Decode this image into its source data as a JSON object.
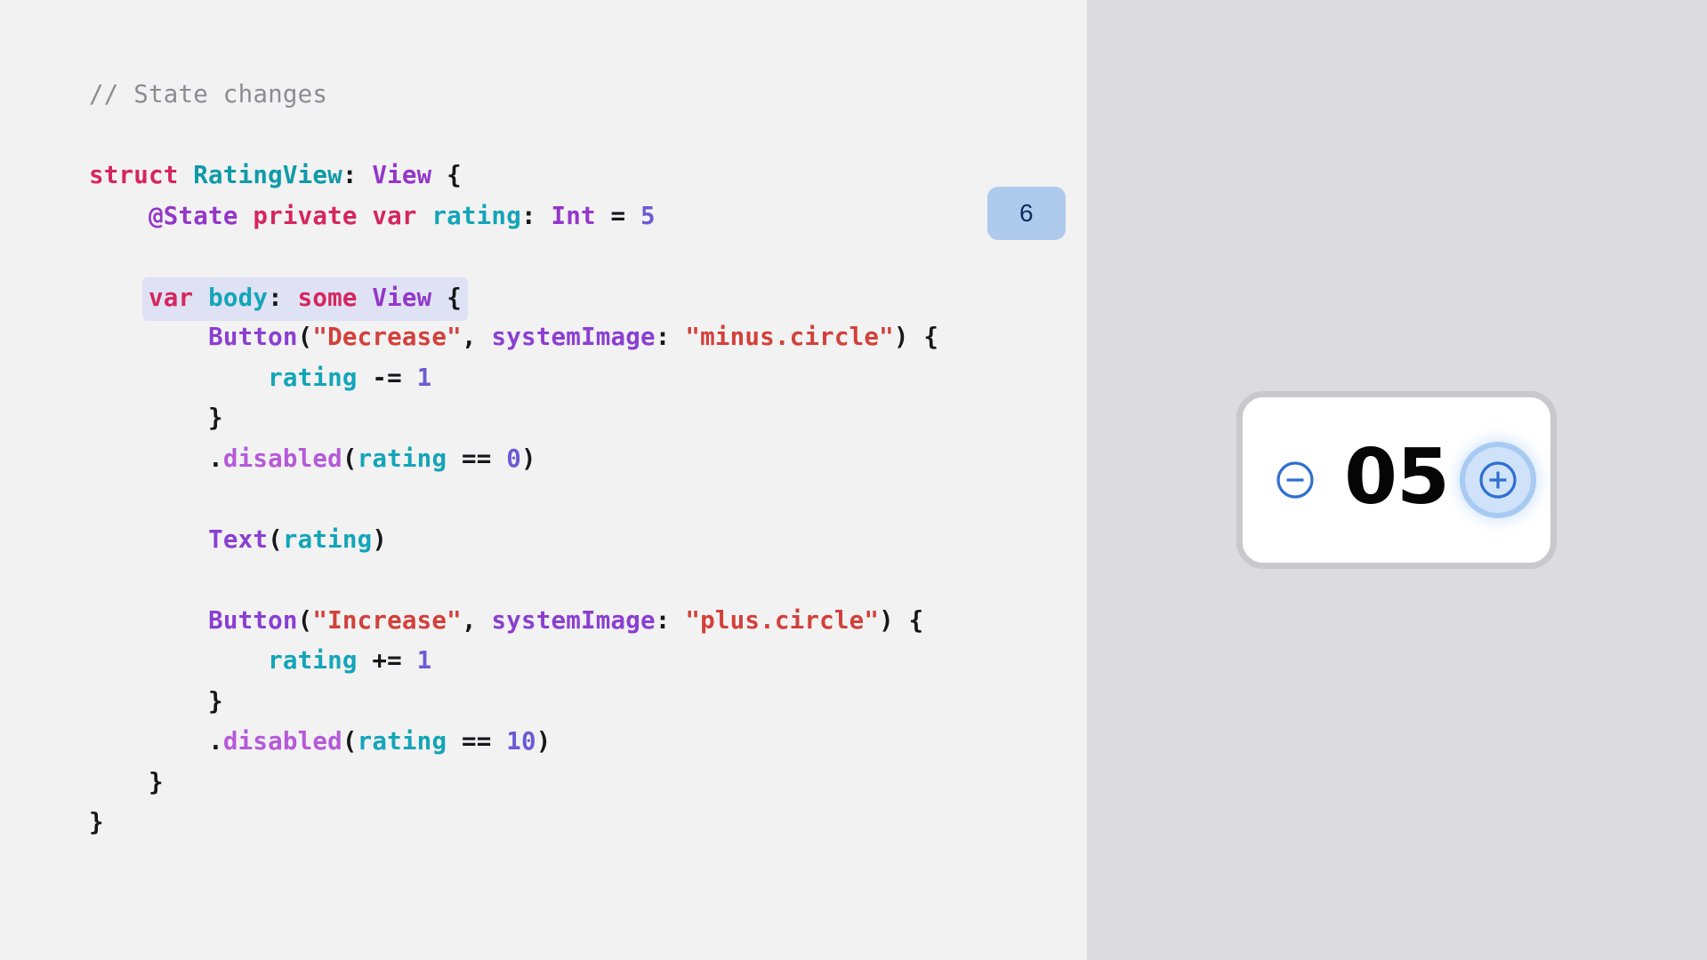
{
  "colors": {
    "left_panel_bg": "#f2f2f3",
    "right_panel_bg": "#dcdce0",
    "badge_bg": "#aecbee",
    "badge_text": "#10295c",
    "highlight_band": "#dfe2f4",
    "card_bg": "#ffffff",
    "card_border": "#c8c8cd",
    "accent_blue": "#2f6fd0",
    "focus_ring": "#a8caf2",
    "focus_fill": "#cfe2fa"
  },
  "code": {
    "language": "swift",
    "lines": [
      {
        "id": "line-comment",
        "highlight": false,
        "tokens": [
          {
            "text": "// State changes",
            "cls": "t-comment"
          }
        ]
      },
      {
        "id": "line-blank-1",
        "highlight": false,
        "tokens": []
      },
      {
        "id": "line-struct",
        "highlight": false,
        "tokens": [
          {
            "text": "struct ",
            "cls": "t-keyword"
          },
          {
            "text": "RatingView",
            "cls": "t-type"
          },
          {
            "text": ": ",
            "cls": "t-punct"
          },
          {
            "text": "View",
            "cls": "t-typeP"
          },
          {
            "text": " {",
            "cls": "t-punct"
          }
        ]
      },
      {
        "id": "line-state",
        "highlight": false,
        "tokens": [
          {
            "text": "    ",
            "cls": "t-plain"
          },
          {
            "text": "@State ",
            "cls": "t-attr"
          },
          {
            "text": "private var ",
            "cls": "t-keyword"
          },
          {
            "text": "rating",
            "cls": "t-var"
          },
          {
            "text": ": ",
            "cls": "t-punct"
          },
          {
            "text": "Int",
            "cls": "t-typeP"
          },
          {
            "text": " = ",
            "cls": "t-punct"
          },
          {
            "text": "5",
            "cls": "t-num"
          }
        ]
      },
      {
        "id": "line-blank-2",
        "highlight": false,
        "tokens": []
      },
      {
        "id": "line-body",
        "highlight": true,
        "indent": 4,
        "tokens": [
          {
            "text": "var ",
            "cls": "t-keyword"
          },
          {
            "text": "body",
            "cls": "t-var"
          },
          {
            "text": ": ",
            "cls": "t-punct"
          },
          {
            "text": "some ",
            "cls": "t-keyword"
          },
          {
            "text": "View",
            "cls": "t-typeP"
          },
          {
            "text": " {",
            "cls": "t-punct"
          }
        ]
      },
      {
        "id": "line-button-decrease",
        "highlight": false,
        "tokens": [
          {
            "text": "        ",
            "cls": "t-plain"
          },
          {
            "text": "Button",
            "cls": "t-func"
          },
          {
            "text": "(",
            "cls": "t-punct"
          },
          {
            "text": "\"Decrease\"",
            "cls": "t-string"
          },
          {
            "text": ", ",
            "cls": "t-punct"
          },
          {
            "text": "systemImage",
            "cls": "t-label"
          },
          {
            "text": ": ",
            "cls": "t-punct"
          },
          {
            "text": "\"minus.circle\"",
            "cls": "t-string"
          },
          {
            "text": ") {",
            "cls": "t-punct"
          }
        ]
      },
      {
        "id": "line-rating-minus",
        "highlight": false,
        "tokens": [
          {
            "text": "            ",
            "cls": "t-plain"
          },
          {
            "text": "rating",
            "cls": "t-var"
          },
          {
            "text": " -= ",
            "cls": "t-punct"
          },
          {
            "text": "1",
            "cls": "t-num"
          }
        ]
      },
      {
        "id": "line-close-decrease",
        "highlight": false,
        "tokens": [
          {
            "text": "        }",
            "cls": "t-punct"
          }
        ]
      },
      {
        "id": "line-disabled-0",
        "highlight": false,
        "tokens": [
          {
            "text": "        ",
            "cls": "t-plain"
          },
          {
            "text": ".",
            "cls": "t-punct"
          },
          {
            "text": "disabled",
            "cls": "t-method"
          },
          {
            "text": "(",
            "cls": "t-punct"
          },
          {
            "text": "rating",
            "cls": "t-var"
          },
          {
            "text": " == ",
            "cls": "t-punct"
          },
          {
            "text": "0",
            "cls": "t-num"
          },
          {
            "text": ")",
            "cls": "t-punct"
          }
        ]
      },
      {
        "id": "line-blank-3",
        "highlight": false,
        "tokens": []
      },
      {
        "id": "line-text-rating",
        "highlight": false,
        "tokens": [
          {
            "text": "        ",
            "cls": "t-plain"
          },
          {
            "text": "Text",
            "cls": "t-func"
          },
          {
            "text": "(",
            "cls": "t-punct"
          },
          {
            "text": "rating",
            "cls": "t-var"
          },
          {
            "text": ")",
            "cls": "t-punct"
          }
        ]
      },
      {
        "id": "line-blank-4",
        "highlight": false,
        "tokens": []
      },
      {
        "id": "line-button-increase",
        "highlight": false,
        "tokens": [
          {
            "text": "        ",
            "cls": "t-plain"
          },
          {
            "text": "Button",
            "cls": "t-func"
          },
          {
            "text": "(",
            "cls": "t-punct"
          },
          {
            "text": "\"Increase\"",
            "cls": "t-string"
          },
          {
            "text": ", ",
            "cls": "t-punct"
          },
          {
            "text": "systemImage",
            "cls": "t-label"
          },
          {
            "text": ": ",
            "cls": "t-punct"
          },
          {
            "text": "\"plus.circle\"",
            "cls": "t-string"
          },
          {
            "text": ") {",
            "cls": "t-punct"
          }
        ]
      },
      {
        "id": "line-rating-plus",
        "highlight": false,
        "tokens": [
          {
            "text": "            ",
            "cls": "t-plain"
          },
          {
            "text": "rating",
            "cls": "t-var"
          },
          {
            "text": " += ",
            "cls": "t-punct"
          },
          {
            "text": "1",
            "cls": "t-num"
          }
        ]
      },
      {
        "id": "line-close-increase",
        "highlight": false,
        "tokens": [
          {
            "text": "        }",
            "cls": "t-punct"
          }
        ]
      },
      {
        "id": "line-disabled-10",
        "highlight": false,
        "tokens": [
          {
            "text": "        ",
            "cls": "t-plain"
          },
          {
            "text": ".",
            "cls": "t-punct"
          },
          {
            "text": "disabled",
            "cls": "t-method"
          },
          {
            "text": "(",
            "cls": "t-punct"
          },
          {
            "text": "rating",
            "cls": "t-var"
          },
          {
            "text": " == ",
            "cls": "t-punct"
          },
          {
            "text": "10",
            "cls": "t-num"
          },
          {
            "text": ")",
            "cls": "t-punct"
          }
        ]
      },
      {
        "id": "line-close-body",
        "highlight": false,
        "tokens": [
          {
            "text": "    }",
            "cls": "t-punct"
          }
        ]
      },
      {
        "id": "line-close-struct",
        "highlight": false,
        "tokens": [
          {
            "text": "}",
            "cls": "t-punct"
          }
        ]
      }
    ]
  },
  "badge": {
    "value": "6"
  },
  "preview": {
    "stepper": {
      "value": "05",
      "decrease_icon": "minus-circle-icon",
      "increase_icon": "plus-circle-icon",
      "focused_control": "increase"
    }
  }
}
